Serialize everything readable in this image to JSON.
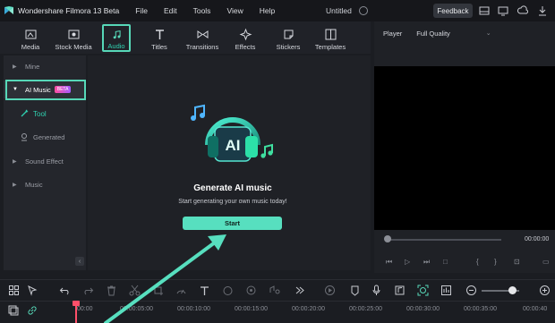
{
  "titlebar": {
    "app_title": "Wondershare Filmora 13 Beta",
    "menu": [
      "File",
      "Edit",
      "Tools",
      "View",
      "Help"
    ],
    "project_title": "Untitled",
    "feedback_label": "Feedback"
  },
  "media_toolbar": {
    "tools": [
      {
        "label": "Media",
        "icon": "media-icon"
      },
      {
        "label": "Stock Media",
        "icon": "stock-media-icon"
      },
      {
        "label": "Audio",
        "icon": "music-note-icon",
        "active": true
      },
      {
        "label": "Titles",
        "icon": "titles-icon"
      },
      {
        "label": "Transitions",
        "icon": "transitions-icon"
      },
      {
        "label": "Effects",
        "icon": "effects-icon"
      },
      {
        "label": "Stickers",
        "icon": "stickers-icon"
      },
      {
        "label": "Templates",
        "icon": "templates-icon"
      }
    ]
  },
  "sidebar": {
    "items": [
      {
        "label": "Mine"
      },
      {
        "label": "AI Music",
        "badge": "BETA",
        "selected": true
      },
      {
        "label": "Tool"
      },
      {
        "label": "Generated"
      },
      {
        "label": "Sound Effect"
      },
      {
        "label": "Music"
      }
    ]
  },
  "main": {
    "hero_text": "AI",
    "heading": "Generate AI music",
    "subheading": "Start generating your own music today!",
    "start_label": "Start"
  },
  "player": {
    "label": "Player",
    "quality": "Full Quality",
    "time": "00:00:00"
  },
  "timeline": {
    "ruler_labels": [
      "00:00",
      "00:00:05:00",
      "00:00:10:00",
      "00:00:15:00",
      "00:00:20:00",
      "00:00:25:00",
      "00:00:30:00",
      "00:00:35:00",
      "00:00:40"
    ]
  },
  "colors": {
    "accent": "#57d8b8",
    "beta_badge": "#d94fd0",
    "playhead": "#ff4f6a"
  }
}
